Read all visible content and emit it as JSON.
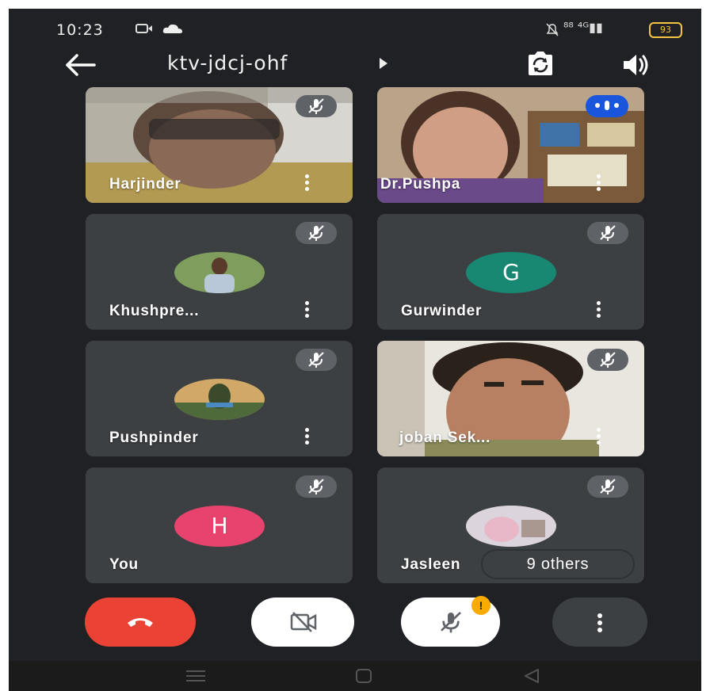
{
  "status_bar": {
    "time": "10:23",
    "battery": "93"
  },
  "header": {
    "meeting_code": "ktv-jdcj-ohf"
  },
  "participants": [
    {
      "name": "Harjinder",
      "muted": true,
      "video": true
    },
    {
      "name": "Dr.Pushpa",
      "muted": false,
      "speaking": true,
      "video": true
    },
    {
      "name": "Khushpre...",
      "muted": true,
      "video": false,
      "avatar": "photo"
    },
    {
      "name": "Gurwinder",
      "muted": true,
      "video": false,
      "avatar_letter": "G",
      "avatar_color": "#188872"
    },
    {
      "name": "Pushpinder",
      "muted": true,
      "video": false,
      "avatar": "photo"
    },
    {
      "name": "joban Sek...",
      "muted": true,
      "video": true
    },
    {
      "name": "You",
      "muted": true,
      "video": false,
      "avatar_letter": "H",
      "avatar_color": "#e8436e"
    },
    {
      "name": "Jasleen",
      "muted": true,
      "video": false,
      "avatar": "photo"
    }
  ],
  "others_chip": "9 others",
  "controls": {
    "badge": "!",
    "colors": {
      "end_call": "#ea4335",
      "badge": "#f9ab00"
    }
  },
  "icons": [
    "back-arrow-icon",
    "dropdown-arrow-icon",
    "switch-camera-icon",
    "speaker-icon",
    "mic-off-icon",
    "more-vert-icon",
    "phone-hangup-icon",
    "camera-off-icon"
  ]
}
